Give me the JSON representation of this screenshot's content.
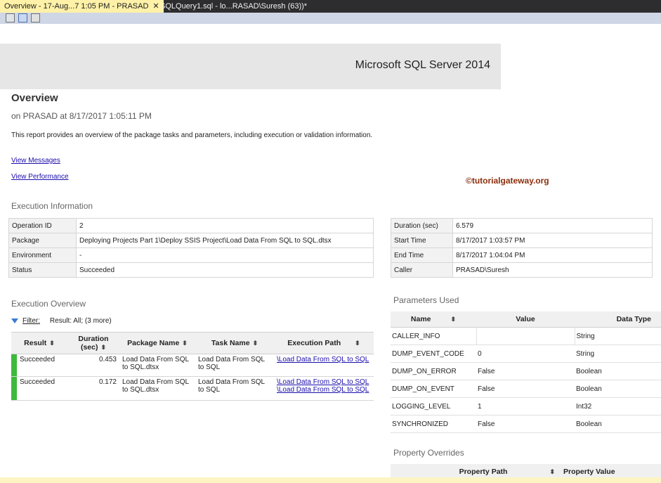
{
  "tabs": {
    "overview_label": "Overview - 17-Aug...7 1:05 PM - PRASAD",
    "close_glyph": "✕",
    "query_label": "SQLQuery1.sql - lo...RASAD\\Suresh (63))*"
  },
  "banner": {
    "brand": "Microsoft SQL Server 2014"
  },
  "report": {
    "title": "Overview",
    "subtitle": "on PRASAD at 8/17/2017 1:05:11 PM",
    "description": "This report provides an overview of the package tasks and parameters, including execution or validation information.",
    "link_messages": "View Messages",
    "link_performance": "View Performance",
    "watermark": "©tutorialgateway.org"
  },
  "execution_info": {
    "section": "Execution Information",
    "left": [
      {
        "key": "Operation ID",
        "value": "2"
      },
      {
        "key": "Package",
        "value": "Deploying Projects Part 1\\Deploy SSIS Project\\Load Data From SQL to SQL.dtsx"
      },
      {
        "key": "Environment",
        "value": "-"
      },
      {
        "key": "Status",
        "value": "Succeeded"
      }
    ],
    "right": [
      {
        "key": "Duration (sec)",
        "value": "6.579"
      },
      {
        "key": "Start Time",
        "value": "8/17/2017 1:03:57 PM"
      },
      {
        "key": "End Time",
        "value": "8/17/2017 1:04:04 PM"
      },
      {
        "key": "Caller",
        "value": "PRASAD\\Suresh"
      }
    ]
  },
  "execution_overview": {
    "section": "Execution Overview",
    "filter_label": "Filter:",
    "filter_text": "Result: All;  (3 more)",
    "sort_glyph": "⬍",
    "columns": [
      "Result",
      "Duration (sec)",
      "Package Name",
      "Task Name",
      "Execution Path"
    ],
    "rows": [
      {
        "result": "Succeeded",
        "duration": "0.453",
        "package": "Load Data From SQL to SQL.dtsx",
        "task": "Load Data From SQL to SQL",
        "path1": "\\Load Data From SQL to SQL",
        "path2": ""
      },
      {
        "result": "Succeeded",
        "duration": "0.172",
        "package": "Load Data From SQL to SQL.dtsx",
        "task": "Load Data From SQL to SQL",
        "path1": "\\Load Data From SQL to SQL",
        "path2": "\\Load Data From SQL to SQL"
      }
    ]
  },
  "parameters": {
    "section": "Parameters Used",
    "columns": [
      "Name",
      "Value",
      "Data Type"
    ],
    "rows": [
      {
        "name": "CALLER_INFO",
        "value": "",
        "type": "String"
      },
      {
        "name": "DUMP_EVENT_CODE",
        "value": "0",
        "type": "String"
      },
      {
        "name": "DUMP_ON_ERROR",
        "value": "False",
        "type": "Boolean"
      },
      {
        "name": "DUMP_ON_EVENT",
        "value": "False",
        "type": "Boolean"
      },
      {
        "name": "LOGGING_LEVEL",
        "value": "1",
        "type": "Int32"
      },
      {
        "name": "SYNCHRONIZED",
        "value": "False",
        "type": "Boolean"
      }
    ]
  },
  "overrides": {
    "section": "Property Overrides",
    "columns": [
      "Property Path",
      "Property Value"
    ]
  }
}
